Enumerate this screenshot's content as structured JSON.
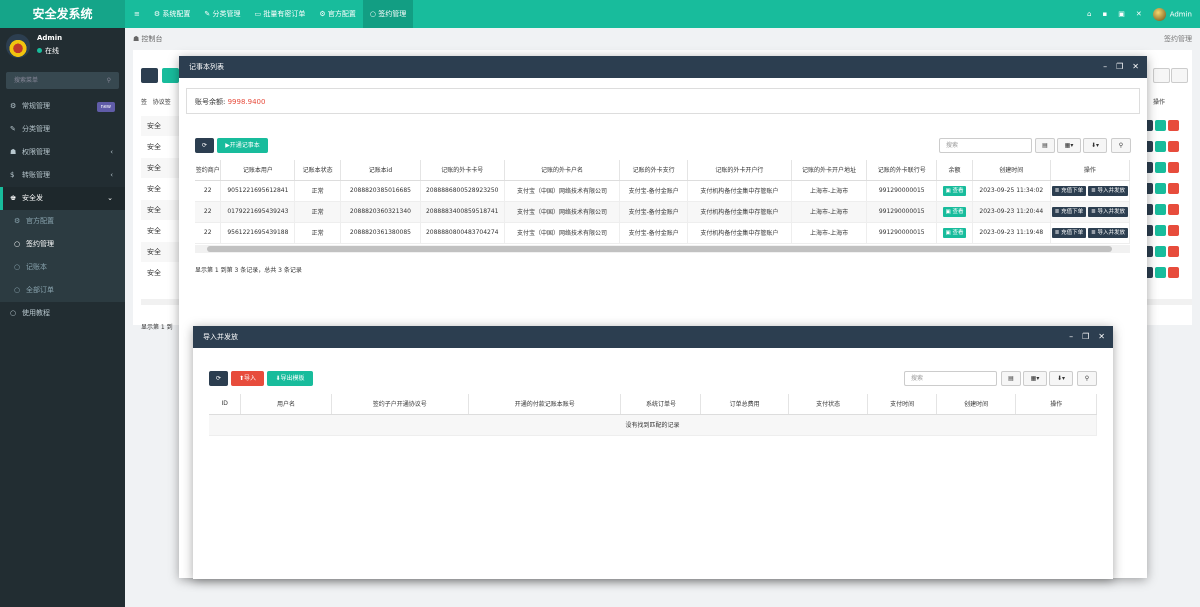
{
  "app": {
    "title": "安全发系统"
  },
  "topnav": [
    {
      "icon": "≡",
      "label": ""
    },
    {
      "icon": "⚙",
      "label": "系统配置"
    },
    {
      "icon": "✎",
      "label": "分类管理"
    },
    {
      "icon": "▭",
      "label": "批量有密订单"
    },
    {
      "icon": "⚙",
      "label": "官方配置"
    },
    {
      "icon": "○",
      "label": "签约管理"
    }
  ],
  "topright": {
    "user": "Admin"
  },
  "sidebar": {
    "user": {
      "name": "Admin",
      "status": "在线"
    },
    "search_placeholder": "搜索菜单",
    "items": [
      {
        "icon": "⚙",
        "label": "常规管理",
        "badge": "new"
      },
      {
        "icon": "✎",
        "label": "分类管理"
      },
      {
        "icon": "☗",
        "label": "权限管理"
      },
      {
        "icon": "$",
        "label": "转账管理"
      },
      {
        "icon": "♚",
        "label": "安全发"
      }
    ],
    "subitems": [
      {
        "icon": "⚙",
        "label": "官方配置"
      },
      {
        "icon": "○",
        "label": "签约管理"
      },
      {
        "icon": "○",
        "label": "记账本"
      },
      {
        "icon": "○",
        "label": "全部订单"
      }
    ],
    "extra": {
      "icon": "○",
      "label": "使用教程"
    }
  },
  "breadcrumb": {
    "home": "控制台",
    "right": "签约管理"
  },
  "bg": {
    "col1": "签",
    "col2": "协议签",
    "rows": [
      "安全",
      "安全",
      "安全",
      "安全",
      "安全",
      "安全",
      "安全",
      "安全"
    ],
    "op_header": "操作",
    "footer": "显示第 1 到"
  },
  "ledger_window": {
    "title": "记事本列表",
    "balance_label": "账号余额:",
    "balance_value": "9998.9400",
    "open_btn": "▶开通记事本",
    "search_placeholder": "搜索",
    "columns": [
      "签约商户",
      "记账本用户",
      "记账本状态",
      "记账本id",
      "记账的外卡卡号",
      "记账的外卡户名",
      "记账的外卡支行",
      "记账的外卡开户行",
      "记账的外卡开户地址",
      "记账的外卡联行号",
      "余额",
      "创建时间",
      "操作"
    ],
    "rows": [
      {
        "merchant": "22",
        "user": "9051221695612841",
        "status": "正常",
        "book_id": "2088820385016685",
        "card_no": "2088886800528923250",
        "account_name": "支付宝（中国）网络技术有限公司",
        "branch": "支付宝-备付金账户",
        "bank": "支付机构备付金集中存管账户",
        "address": "上海市-上海市",
        "bank_code": "991290000015",
        "balance": "查看",
        "created": "2023-09-25 11:34:02"
      },
      {
        "merchant": "22",
        "user": "0179221695439243",
        "status": "正常",
        "book_id": "2088820360321340",
        "card_no": "2088883400859518741",
        "account_name": "支付宝（中国）网络技术有限公司",
        "branch": "支付宝-备付金账户",
        "bank": "支付机构备付金集中存管账户",
        "address": "上海市-上海市",
        "bank_code": "991290000015",
        "balance": "查看",
        "created": "2023-09-23 11:20:44"
      },
      {
        "merchant": "22",
        "user": "9561221695439188",
        "status": "正常",
        "book_id": "2088820361380085",
        "card_no": "2088880800483704274",
        "account_name": "支付宝（中国）网络技术有限公司",
        "branch": "支付宝-备付金账户",
        "bank": "支付机构备付金集中存管账户",
        "address": "上海市-上海市",
        "bank_code": "991290000015",
        "balance": "查看",
        "created": "2023-09-23 11:19:48"
      }
    ],
    "op_labels": [
      "充值下单",
      "导入并发放"
    ],
    "footer": "显示第 1 到第 3 条记录，总共 3 条记录"
  },
  "import_window": {
    "title": "导入并发放",
    "import_btn": "导入",
    "export_btn": "导出模板",
    "search_placeholder": "搜索",
    "columns": [
      "ID",
      "用户名",
      "签约子户开通协议号",
      "开通的付款记账本账号",
      "系统订单号",
      "订单总费用",
      "支付状态",
      "支付时间",
      "创建时间",
      "操作"
    ],
    "empty": "没有找到匹配的记录"
  },
  "colors": {
    "accent": "#18bc9c",
    "dark": "#2c3e50",
    "danger": "#e74c3c",
    "sidebar": "#222d32"
  }
}
